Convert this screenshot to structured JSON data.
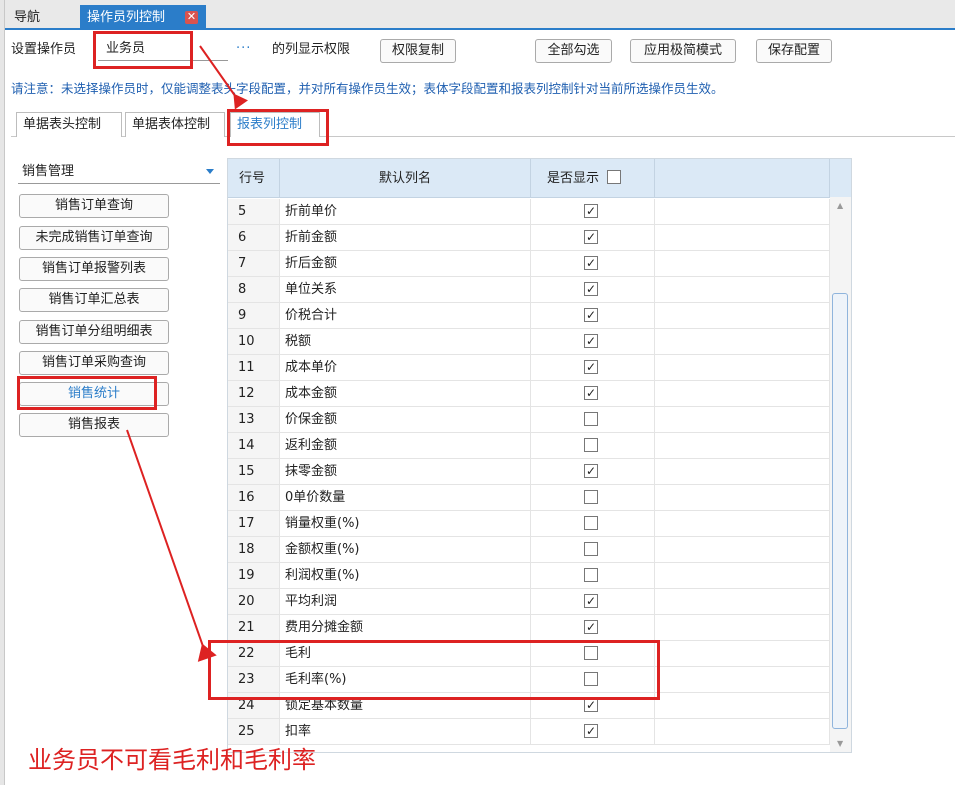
{
  "tabs": {
    "nav": "导航",
    "active": "操作员列控制",
    "close_glyph": "✕"
  },
  "toolbar": {
    "set_operator_label": "设置操作员",
    "operator_value": "业务员",
    "ellipsis": "···",
    "permission_label": "的列显示权限",
    "copy_btn": "权限复制",
    "check_all_btn": "全部勾选",
    "simple_mode_btn": "应用极简模式",
    "save_btn": "保存配置"
  },
  "notice": "请注意：未选择操作员时，仅能调整表头字段配置，并对所有操作员生效；表体字段配置和报表列控制针对当前所选操作员生效。",
  "subtabs": [
    "单据表头控制",
    "单据表体控制",
    "报表列控制"
  ],
  "category_select": "销售管理",
  "reports": [
    "销售订单查询",
    "未完成销售订单查询",
    "销售订单报警列表",
    "销售订单汇总表",
    "销售订单分组明细表",
    "销售订单采购查询",
    "销售统计",
    "销售报表"
  ],
  "grid": {
    "headers": {
      "no": "行号",
      "name": "默认列名",
      "show": "是否显示"
    },
    "rows": [
      {
        "no": "5",
        "name": "折前单价",
        "checked": true
      },
      {
        "no": "6",
        "name": "折前金额",
        "checked": true
      },
      {
        "no": "7",
        "name": "折后金额",
        "checked": true
      },
      {
        "no": "8",
        "name": "单位关系",
        "checked": true
      },
      {
        "no": "9",
        "name": "价税合计",
        "checked": true
      },
      {
        "no": "10",
        "name": "税额",
        "checked": true
      },
      {
        "no": "11",
        "name": "成本单价",
        "checked": true
      },
      {
        "no": "12",
        "name": "成本金额",
        "checked": true
      },
      {
        "no": "13",
        "name": "价保金额",
        "checked": false
      },
      {
        "no": "14",
        "name": "返利金额",
        "checked": false
      },
      {
        "no": "15",
        "name": "抹零金额",
        "checked": true
      },
      {
        "no": "16",
        "name": "0单价数量",
        "checked": false
      },
      {
        "no": "17",
        "name": "销量权重(%)",
        "checked": false
      },
      {
        "no": "18",
        "name": "金额权重(%)",
        "checked": false
      },
      {
        "no": "19",
        "name": "利润权重(%)",
        "checked": false
      },
      {
        "no": "20",
        "name": "平均利润",
        "checked": true
      },
      {
        "no": "21",
        "name": "费用分摊金额",
        "checked": true
      },
      {
        "no": "22",
        "name": "毛利",
        "checked": false
      },
      {
        "no": "23",
        "name": "毛利率(%)",
        "checked": false
      },
      {
        "no": "24",
        "name": "锁定基本数量",
        "checked": true
      },
      {
        "no": "25",
        "name": "扣率",
        "checked": true
      }
    ]
  },
  "annotation": {
    "caption": "业务员不可看毛利和毛利率",
    "color": "#dd2222"
  },
  "colors": {
    "accent": "#2b7dc9",
    "annotation": "#dd2222",
    "header_bg": "#dbe9f6"
  }
}
